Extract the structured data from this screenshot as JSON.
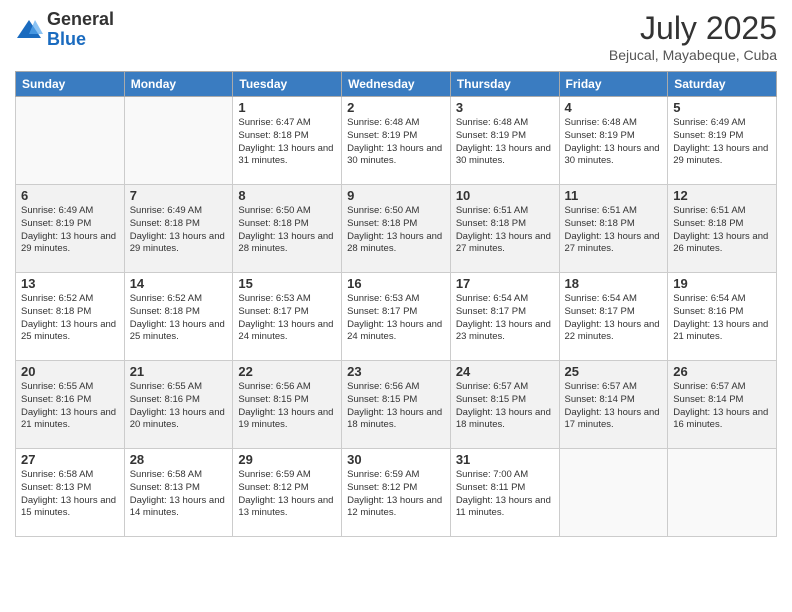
{
  "logo": {
    "general": "General",
    "blue": "Blue"
  },
  "title": "July 2025",
  "subtitle": "Bejucal, Mayabeque, Cuba",
  "days_header": [
    "Sunday",
    "Monday",
    "Tuesday",
    "Wednesday",
    "Thursday",
    "Friday",
    "Saturday"
  ],
  "weeks": [
    [
      {
        "day": "",
        "info": ""
      },
      {
        "day": "",
        "info": ""
      },
      {
        "day": "1",
        "info": "Sunrise: 6:47 AM\nSunset: 8:18 PM\nDaylight: 13 hours and 31 minutes."
      },
      {
        "day": "2",
        "info": "Sunrise: 6:48 AM\nSunset: 8:19 PM\nDaylight: 13 hours and 30 minutes."
      },
      {
        "day": "3",
        "info": "Sunrise: 6:48 AM\nSunset: 8:19 PM\nDaylight: 13 hours and 30 minutes."
      },
      {
        "day": "4",
        "info": "Sunrise: 6:48 AM\nSunset: 8:19 PM\nDaylight: 13 hours and 30 minutes."
      },
      {
        "day": "5",
        "info": "Sunrise: 6:49 AM\nSunset: 8:19 PM\nDaylight: 13 hours and 29 minutes."
      }
    ],
    [
      {
        "day": "6",
        "info": "Sunrise: 6:49 AM\nSunset: 8:19 PM\nDaylight: 13 hours and 29 minutes."
      },
      {
        "day": "7",
        "info": "Sunrise: 6:49 AM\nSunset: 8:18 PM\nDaylight: 13 hours and 29 minutes."
      },
      {
        "day": "8",
        "info": "Sunrise: 6:50 AM\nSunset: 8:18 PM\nDaylight: 13 hours and 28 minutes."
      },
      {
        "day": "9",
        "info": "Sunrise: 6:50 AM\nSunset: 8:18 PM\nDaylight: 13 hours and 28 minutes."
      },
      {
        "day": "10",
        "info": "Sunrise: 6:51 AM\nSunset: 8:18 PM\nDaylight: 13 hours and 27 minutes."
      },
      {
        "day": "11",
        "info": "Sunrise: 6:51 AM\nSunset: 8:18 PM\nDaylight: 13 hours and 27 minutes."
      },
      {
        "day": "12",
        "info": "Sunrise: 6:51 AM\nSunset: 8:18 PM\nDaylight: 13 hours and 26 minutes."
      }
    ],
    [
      {
        "day": "13",
        "info": "Sunrise: 6:52 AM\nSunset: 8:18 PM\nDaylight: 13 hours and 25 minutes."
      },
      {
        "day": "14",
        "info": "Sunrise: 6:52 AM\nSunset: 8:18 PM\nDaylight: 13 hours and 25 minutes."
      },
      {
        "day": "15",
        "info": "Sunrise: 6:53 AM\nSunset: 8:17 PM\nDaylight: 13 hours and 24 minutes."
      },
      {
        "day": "16",
        "info": "Sunrise: 6:53 AM\nSunset: 8:17 PM\nDaylight: 13 hours and 24 minutes."
      },
      {
        "day": "17",
        "info": "Sunrise: 6:54 AM\nSunset: 8:17 PM\nDaylight: 13 hours and 23 minutes."
      },
      {
        "day": "18",
        "info": "Sunrise: 6:54 AM\nSunset: 8:17 PM\nDaylight: 13 hours and 22 minutes."
      },
      {
        "day": "19",
        "info": "Sunrise: 6:54 AM\nSunset: 8:16 PM\nDaylight: 13 hours and 21 minutes."
      }
    ],
    [
      {
        "day": "20",
        "info": "Sunrise: 6:55 AM\nSunset: 8:16 PM\nDaylight: 13 hours and 21 minutes."
      },
      {
        "day": "21",
        "info": "Sunrise: 6:55 AM\nSunset: 8:16 PM\nDaylight: 13 hours and 20 minutes."
      },
      {
        "day": "22",
        "info": "Sunrise: 6:56 AM\nSunset: 8:15 PM\nDaylight: 13 hours and 19 minutes."
      },
      {
        "day": "23",
        "info": "Sunrise: 6:56 AM\nSunset: 8:15 PM\nDaylight: 13 hours and 18 minutes."
      },
      {
        "day": "24",
        "info": "Sunrise: 6:57 AM\nSunset: 8:15 PM\nDaylight: 13 hours and 18 minutes."
      },
      {
        "day": "25",
        "info": "Sunrise: 6:57 AM\nSunset: 8:14 PM\nDaylight: 13 hours and 17 minutes."
      },
      {
        "day": "26",
        "info": "Sunrise: 6:57 AM\nSunset: 8:14 PM\nDaylight: 13 hours and 16 minutes."
      }
    ],
    [
      {
        "day": "27",
        "info": "Sunrise: 6:58 AM\nSunset: 8:13 PM\nDaylight: 13 hours and 15 minutes."
      },
      {
        "day": "28",
        "info": "Sunrise: 6:58 AM\nSunset: 8:13 PM\nDaylight: 13 hours and 14 minutes."
      },
      {
        "day": "29",
        "info": "Sunrise: 6:59 AM\nSunset: 8:12 PM\nDaylight: 13 hours and 13 minutes."
      },
      {
        "day": "30",
        "info": "Sunrise: 6:59 AM\nSunset: 8:12 PM\nDaylight: 13 hours and 12 minutes."
      },
      {
        "day": "31",
        "info": "Sunrise: 7:00 AM\nSunset: 8:11 PM\nDaylight: 13 hours and 11 minutes."
      },
      {
        "day": "",
        "info": ""
      },
      {
        "day": "",
        "info": ""
      }
    ]
  ]
}
